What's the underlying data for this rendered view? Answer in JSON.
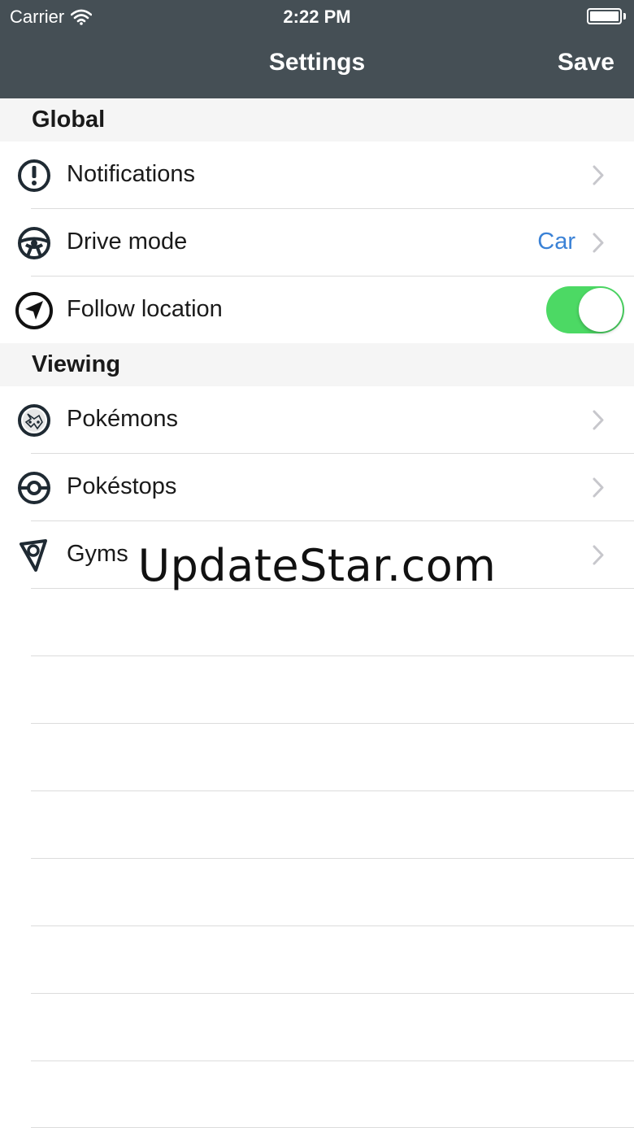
{
  "status_bar": {
    "carrier": "Carrier",
    "time": "2:22 PM",
    "wifi_icon": "wifi-icon",
    "battery_icon": "battery-icon"
  },
  "nav_bar": {
    "title": "Settings",
    "save_label": "Save",
    "background": "#454f55"
  },
  "sections": [
    {
      "title": "Global",
      "items": [
        {
          "label": "Notifications",
          "icon": "exclamation-circle-icon",
          "value": "",
          "control": "chevron"
        },
        {
          "label": "Drive mode",
          "icon": "steering-wheel-icon",
          "value": "Car",
          "control": "chevron"
        },
        {
          "label": "Follow location",
          "icon": "location-arrow-icon",
          "value": "",
          "control": "toggle",
          "toggle_on": true
        }
      ]
    },
    {
      "title": "Viewing",
      "items": [
        {
          "label": "Pokémons",
          "icon": "pokemon-icon",
          "value": "",
          "control": "chevron"
        },
        {
          "label": "Pokéstops",
          "icon": "pokestop-icon",
          "value": "",
          "control": "chevron"
        },
        {
          "label": "Gyms",
          "icon": "gym-map-pin-icon",
          "value": "",
          "control": "chevron"
        }
      ]
    }
  ],
  "watermark": "UpdateStar.com",
  "colors": {
    "accent_value": "#3b82d6",
    "toggle_on": "#4cd964",
    "section_background": "#f5f5f5"
  }
}
